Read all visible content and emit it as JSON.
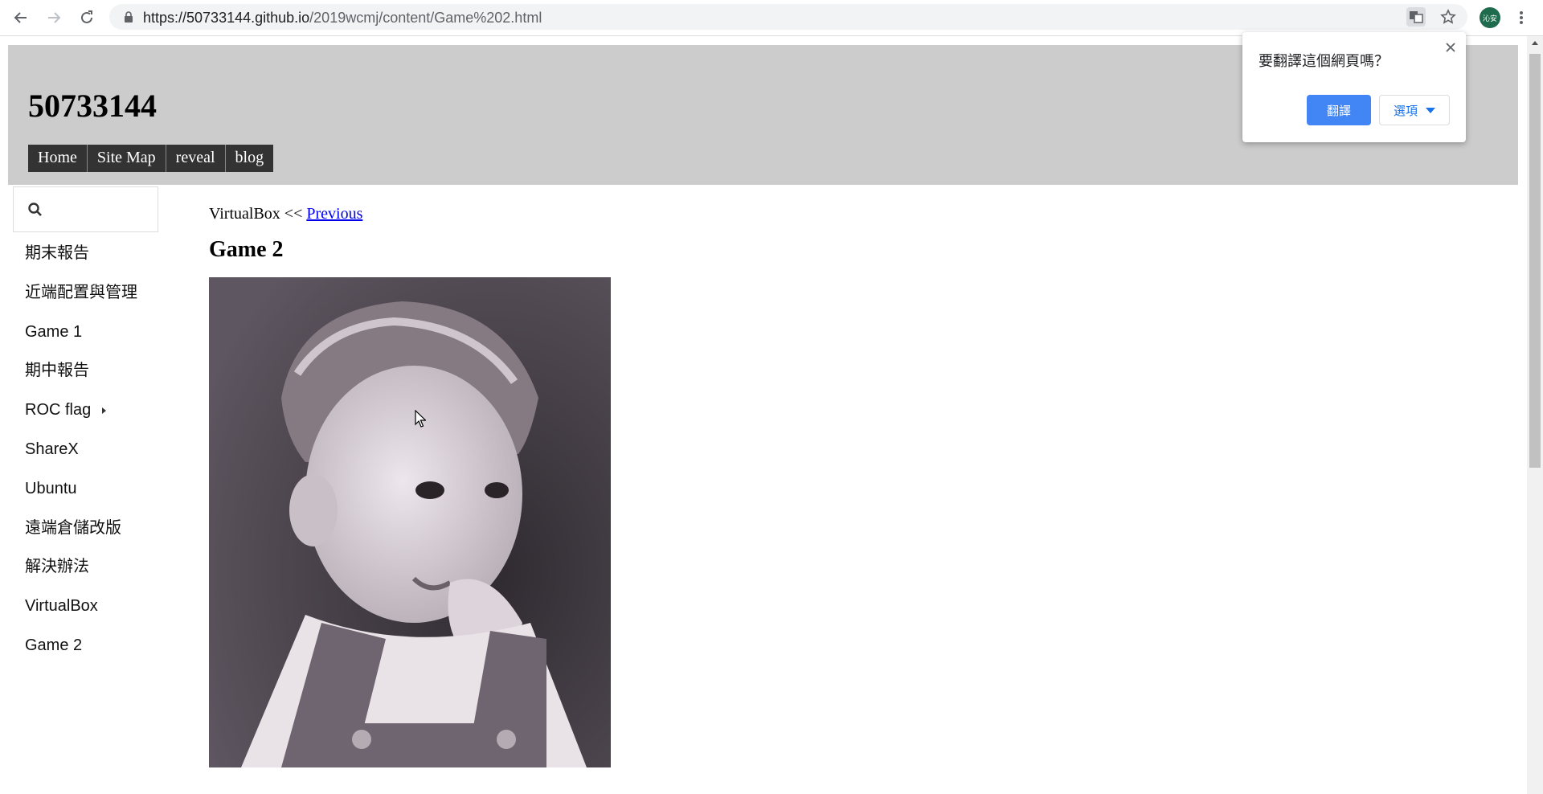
{
  "browser": {
    "url_scheme_host": "https://50733144.github.io",
    "url_path": "/2019wcmj/content/Game%202.html",
    "profile_initials": "沁安"
  },
  "header": {
    "site_title": "50733144",
    "menu": [
      "Home",
      "Site Map",
      "reveal",
      "blog"
    ]
  },
  "sidebar": {
    "search_placeholder": "",
    "items": [
      {
        "label": "期末報告"
      },
      {
        "label": "近端配置與管理"
      },
      {
        "label": "Game 1"
      },
      {
        "label": "期中報告"
      },
      {
        "label": "ROC flag",
        "has_children": true
      },
      {
        "label": "ShareX"
      },
      {
        "label": "Ubuntu"
      },
      {
        "label": "遠端倉儲改版"
      },
      {
        "label": "解決辦法"
      },
      {
        "label": "VirtualBox"
      },
      {
        "label": "Game 2"
      }
    ]
  },
  "content": {
    "prev_text": "VirtualBox <<",
    "prev_link": "Previous",
    "title": "Game 2"
  },
  "translate_popup": {
    "question": "要翻譯這個網頁嗎？",
    "translate_label": "翻譯",
    "options_label": "選項"
  },
  "colors": {
    "header_bg": "#cccccc",
    "menu_bg": "#333333",
    "translate_button": "#4285f4",
    "profile_bg": "#1e6b4d"
  }
}
